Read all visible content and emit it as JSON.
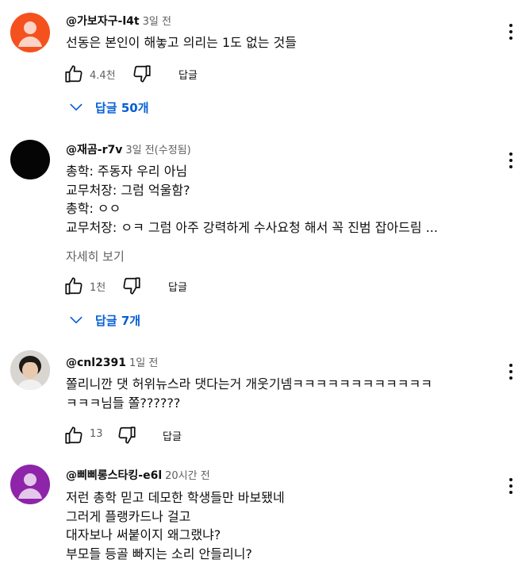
{
  "comments": [
    {
      "author": "@가보자구-l4t",
      "time": "3일 전",
      "lines": [
        "선동은 본인이 해놓고 의리는 1도 없는 것들"
      ],
      "likes": "4.4천",
      "reply_label": "답글",
      "replies_label": "답글 50개",
      "avatar_icon": "default-person-avatar",
      "avatar_color": "#f4511e"
    },
    {
      "author": "@재곰-r7v",
      "time": "3일 전(수정됨)",
      "lines": [
        "총학: 주동자 우리 아님",
        "교무처장: 그럼 억울함?",
        "총학: ㅇㅇ",
        "교무처장: ㅇㅋ 그럼 아주 강력하게 수사요청 해서 꼭 진범 잡아드림 ..."
      ],
      "more_label": "자세히 보기",
      "likes": "1천",
      "reply_label": "답글",
      "replies_label": "답글 7개",
      "avatar_color": "#050505"
    },
    {
      "author": "@cnl2391",
      "time": "1일 전",
      "lines": [
        "쫄리니깐 댓 허위뉴스라 댓다는거 개웃기넴ㅋㅋㅋㅋㅋㅋㅋㅋㅋㅋㅋㅋ",
        "ㅋㅋㅋ님들 쫄??????"
      ],
      "likes": "13",
      "reply_label": "답글",
      "avatar_icon": "person-photo-avatar"
    },
    {
      "author": "@삐삐롱스타킹-e6l",
      "time": "20시간 전",
      "lines": [
        "저런 총학 믿고 데모한 학생들만 바보됐네",
        "그러게 플랭카드나 걸고",
        "대자보나 써붙이지 왜그랬냐?",
        "부모들 등골 빠지는 소리 안들리니?"
      ],
      "avatar_icon": "default-person-avatar",
      "avatar_color": "#8e24aa"
    }
  ],
  "colors": {
    "link_blue": "#065fd4",
    "secondary_text": "#606060"
  }
}
